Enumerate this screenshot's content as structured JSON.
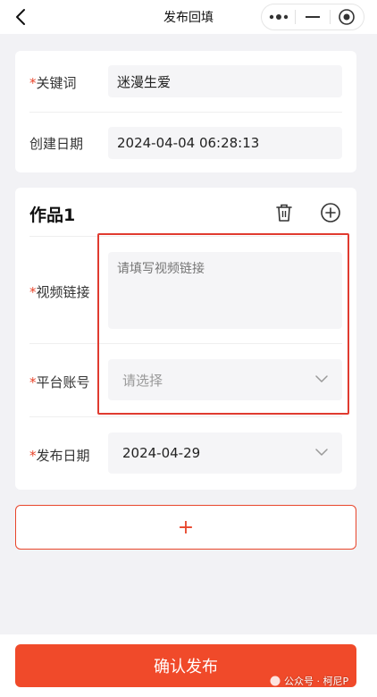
{
  "nav": {
    "title": "发布回填",
    "back_icon": "chevron-left-icon",
    "capsule": [
      "more-icon",
      "minimize-icon",
      "target-icon"
    ]
  },
  "basic": {
    "keyword_label": "关键词",
    "keyword_value": "迷漫生爱",
    "created_label": "创建日期",
    "created_value": "2024-04-04 06:28:13"
  },
  "work": {
    "title": "作品1",
    "video_link_label": "视频链接",
    "video_link_placeholder": "请填写视频链接",
    "platform_label": "平台账号",
    "platform_placeholder": "请选择",
    "publish_date_label": "发布日期",
    "publish_date_value": "2024-04-29"
  },
  "add_work_label": "+",
  "confirm_label": "确认发布",
  "watermark": "公众号 · 柯尼P",
  "required_mark": "*",
  "colors": {
    "accent": "#f04a2a",
    "required": "#e8452b",
    "highlight": "#e03b30"
  }
}
